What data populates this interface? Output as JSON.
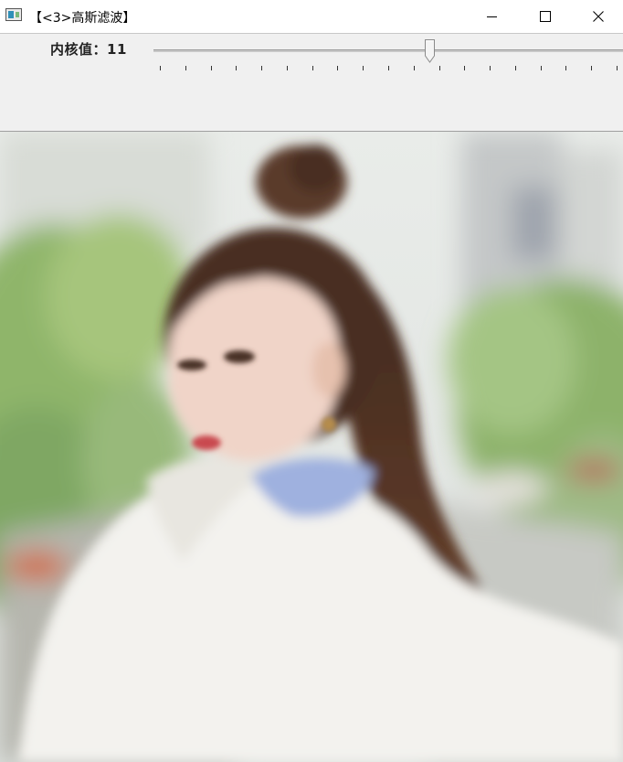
{
  "window": {
    "title": "【<3>高斯滤波】",
    "controls": [
      "minimize-icon",
      "maximize-icon",
      "close-icon"
    ]
  },
  "toolbar": {
    "trackbar": {
      "label": "内核值：",
      "value_text": "11",
      "value_fraction": 0.59,
      "tick_count": 19
    }
  },
  "image": {
    "description_icon": "photo",
    "colors": {
      "sky": "#e8ebea",
      "foliage": "#9bbd6e",
      "hair": "#4a2d22",
      "skin": "#f1d6cc",
      "hoodie": "#f4f3f0",
      "collar": "#9fb0e0"
    }
  }
}
